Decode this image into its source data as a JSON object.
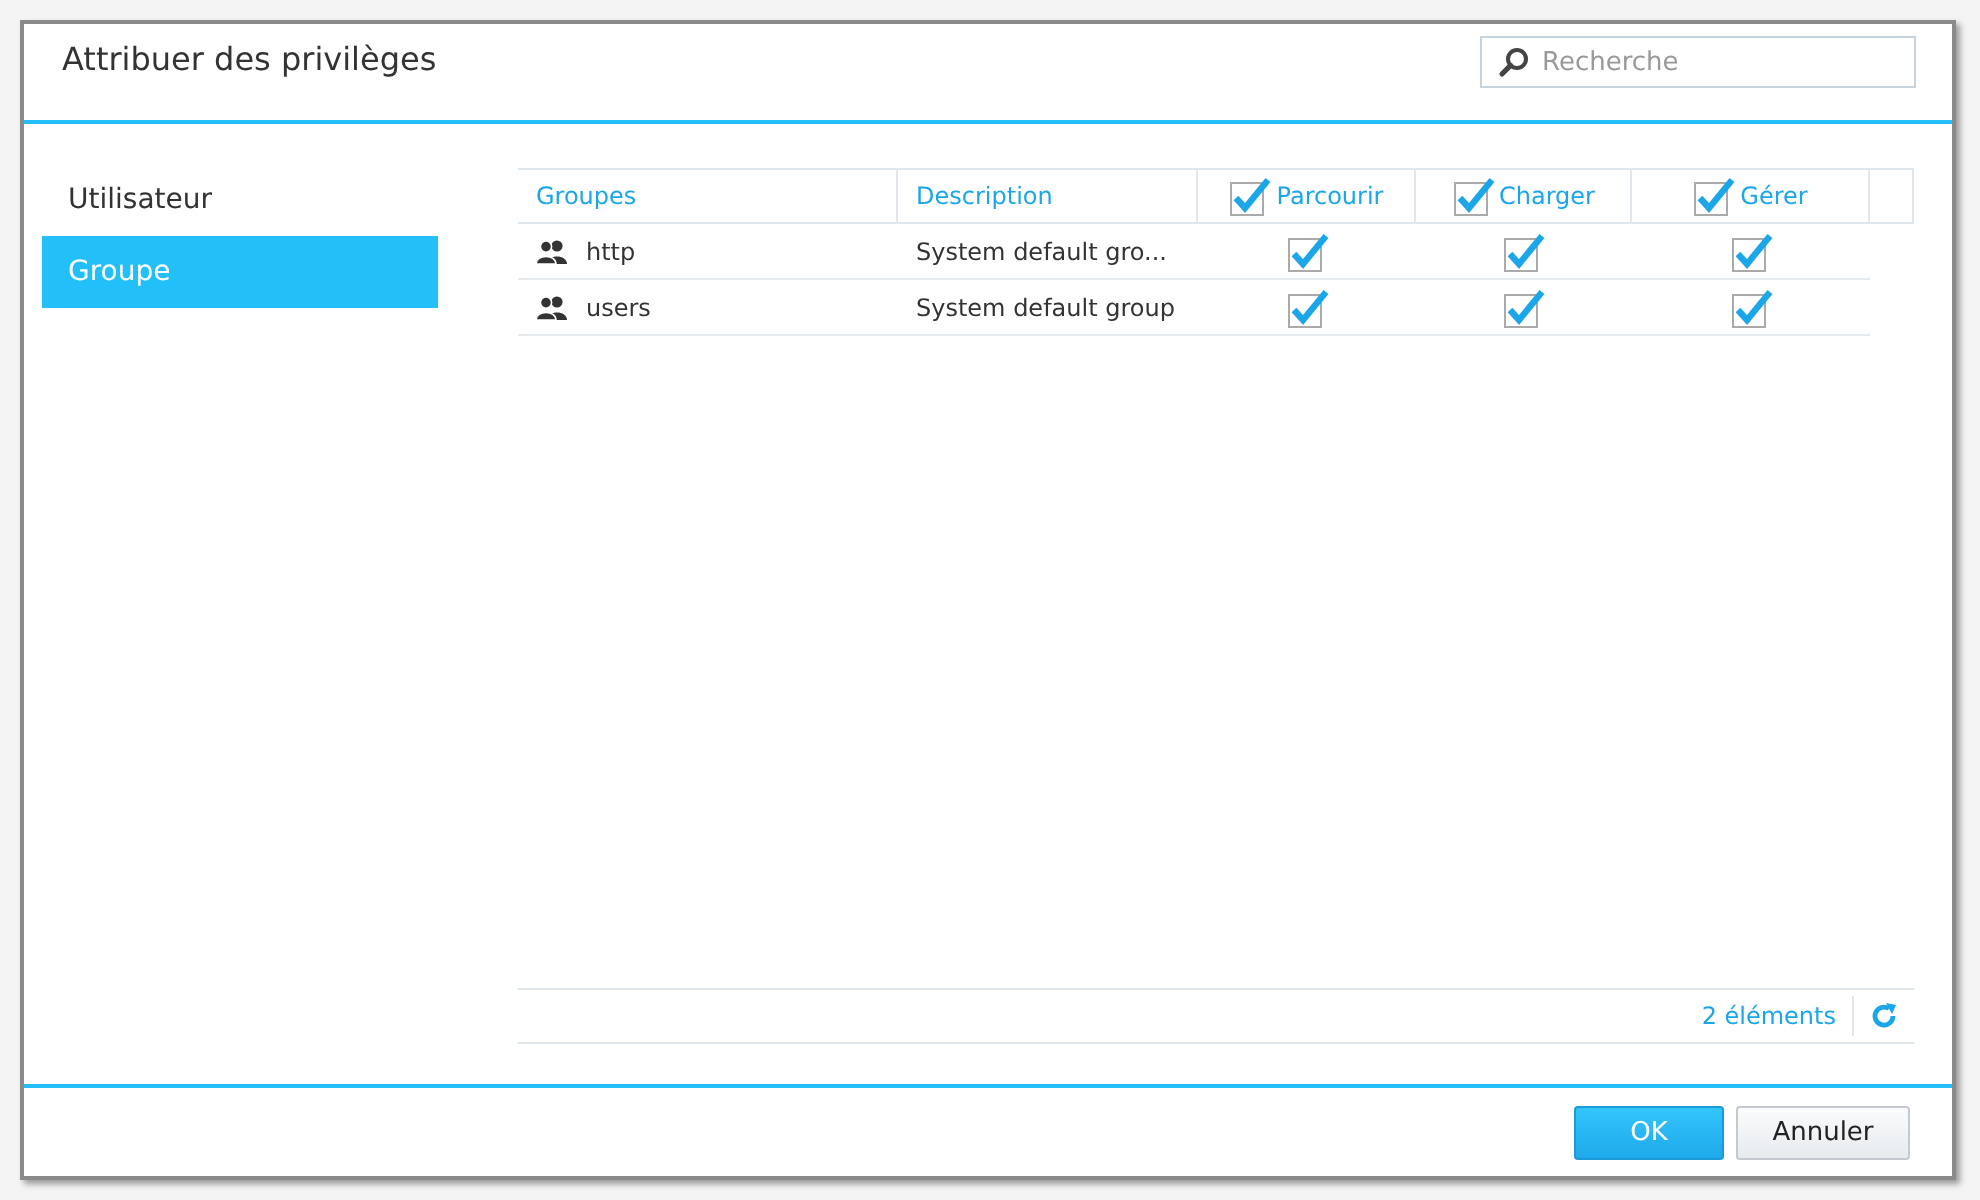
{
  "window": {
    "title": "Attribuer des privilèges"
  },
  "search": {
    "placeholder": "Recherche"
  },
  "sidebar": {
    "items": [
      {
        "label": "Utilisateur",
        "selected": false
      },
      {
        "label": "Groupe",
        "selected": true
      }
    ]
  },
  "table": {
    "columns": [
      {
        "kind": "text",
        "label": "Groupes"
      },
      {
        "kind": "text",
        "label": "Description"
      },
      {
        "kind": "checkbox",
        "label": "Parcourir",
        "checked": true
      },
      {
        "kind": "checkbox",
        "label": "Charger",
        "checked": true
      },
      {
        "kind": "checkbox",
        "label": "Gérer",
        "checked": true
      }
    ],
    "rows": [
      {
        "name": "http",
        "description": "System default gro...",
        "perms": [
          true,
          true,
          true
        ]
      },
      {
        "name": "users",
        "description": "System default group",
        "perms": [
          true,
          true,
          true
        ]
      }
    ]
  },
  "status_bar": {
    "count": "2 éléments"
  },
  "buttons": [
    {
      "kind": "primary",
      "label": "OK"
    },
    {
      "kind": "default",
      "label": "Annuler"
    }
  ]
}
